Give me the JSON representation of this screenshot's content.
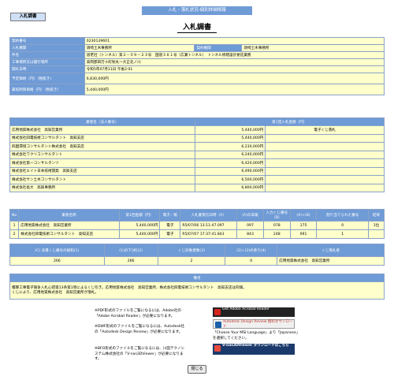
{
  "window": {
    "title": "入札・落札状況-個別詳細情報"
  },
  "tab": {
    "label": "入札調書"
  },
  "page_title": "入札調書",
  "info_rows": [
    {
      "label": "契約番号",
      "value": "0230139601"
    },
    {
      "label": "入札機関",
      "value": "須崎土木事務所"
    },
    {
      "label": "件名",
      "value": "道老社（トンネル）第２－０９－２３号　国道３８１号（広瀬トンネル）　トンネル修繕設計委託業務"
    },
    {
      "label": "工事場所又は履行場所",
      "value": "高岡郡四万十町秋丸～大正北ノ川"
    },
    {
      "label": "開札日時",
      "value": "令和5年07月11日 午後2:01"
    },
    {
      "label": "予定価格（円）（税抜き）",
      "value": "6,830,000円"
    },
    {
      "label": "最低制限価格（円）（税抜き）",
      "value": "5,440,000円"
    }
  ],
  "info_label2": "契約機関",
  "info_value2": "須崎土木事務所",
  "bidders": {
    "headers": [
      "業者名（法人番号）",
      "第1回入札金額（円）"
    ],
    "rows": [
      {
        "name": "応用地質株式会社　高知営業所",
        "amount": "5,440,000円",
        "note": "電子くじ落札"
      },
      {
        "name": "株式会社四電技術コンサルタント　高知支店",
        "amount": "5,440,000円",
        "note": ""
      },
      {
        "name": "四国環境コンサルタント株式会社　高知支店",
        "amount": "6,230,000円",
        "note": ""
      },
      {
        "name": "株式会社ワクリコンサルタント",
        "amount": "6,240,000円",
        "note": ""
      },
      {
        "name": "株式会社第一コンサルタンツ",
        "amount": "6,420,000円",
        "note": ""
      },
      {
        "name": "株式会社エイト日本技術開発　高知支店",
        "amount": "6,490,000円",
        "note": ""
      },
      {
        "name": "株式会社サン土木コンサルタント",
        "amount": "6,500,000円",
        "note": ""
      },
      {
        "name": "株式会社長大　高知事務所",
        "amount": "6,800,000円",
        "note": ""
      }
    ]
  },
  "lottery": {
    "headers": [
      "No",
      "業者名称",
      "第1回金額（円）",
      "電子／紙",
      "入札書受信日時（A）",
      "(A)の末尾",
      "入力くじ番号（B）",
      "(A)+(B)",
      "割り当てられた番号",
      "結果"
    ],
    "rows": [
      {
        "no": "1",
        "name": "応用地質株式会社　高知営業所",
        "amount": "5,440,000円",
        "mode": "電子",
        "received": "R5/07/06 13:11:47.097",
        "tail": "097",
        "input": "078",
        "sum": "175",
        "assigned": "0",
        "result": "1位"
      },
      {
        "no": "2",
        "name": "株式会社四電技術コンサルタント　高知支店",
        "amount": "5,440,000円",
        "mode": "電子",
        "received": "R5/07/07 17:37:41.843",
        "tail": "843",
        "input": "248",
        "sum": "091",
        "assigned": "1",
        "result": ""
      }
    ]
  },
  "summary": {
    "headers": [
      "(C) 派遣くじ番号の総和(1)",
      "(1)の下3桁(2)",
      "くじ対象者数(3)",
      "(2)÷(3)の余り(4)",
      "くじ落札者"
    ],
    "values": [
      "266",
      "266",
      "2",
      "0",
      "応用地質株式会社　高知営業所"
    ]
  },
  "remarks": {
    "header": "備考",
    "text1": "積算工事電子競争入札心得第13条第1項によるくじ引き。応用地質株式会社　高知営業所、株式会社四電技術コンサルタント　高知支店は同価。",
    "text2": "くじにより、応用地質株式会社　高知営業所が落札。"
  },
  "help": {
    "pdf": "※PDF形式のファイルをご覧になるには、Adobe社の「Adobe Acrobat Reader」が必要になります。",
    "dwf": "※DWF形式のファイルをご覧になるには、Autodesk社の「Autodesk Design Review」が必要になります。",
    "dwf_note": "「Choose Your MSI Language」より「Japanese」を選択してください。",
    "bfo": "※BFO形式のファイルをご覧になるには、川田テクノシステム株式会社の「V-nas3DViewer」が必要になります。",
    "badge_adobe": "Get Adobe Acrobat Reader",
    "badge_autodesk": "Autodesk Design Review 無料ダウンロード",
    "badge_vnas": "V-nas3DViewer ダウンロードはこちら"
  },
  "close_button": "閉じる",
  "colors": {
    "header_blue": "#6f9bd6",
    "cell_yellow": "#ffffcc"
  }
}
